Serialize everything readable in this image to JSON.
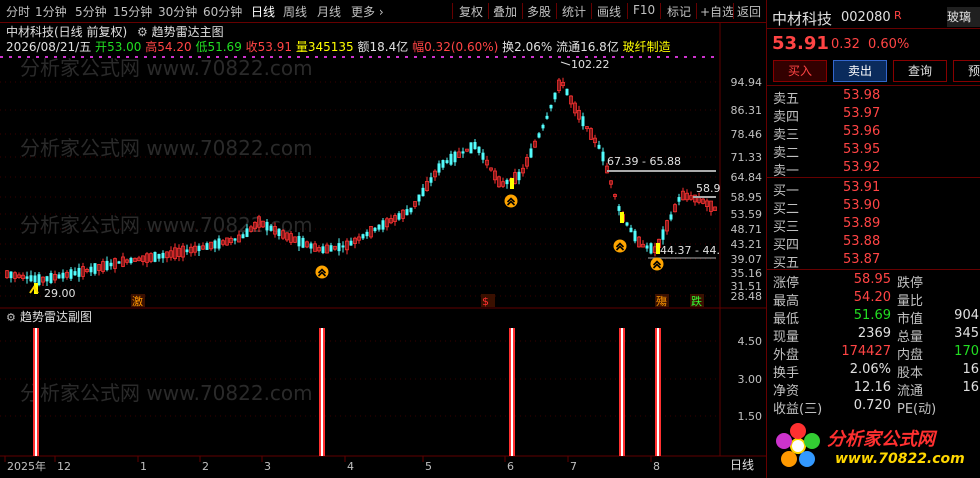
{
  "toolbar": {
    "items": [
      "分时",
      "1分钟",
      "5分钟",
      "15分钟",
      "30分钟",
      "60分钟",
      "日线",
      "周线",
      "月线",
      "更多 ›"
    ],
    "actions": [
      "复权",
      "叠加",
      "多股",
      "统计",
      "画线",
      "F10",
      "标记",
      "+自选",
      "返回"
    ]
  },
  "chart": {
    "title": "中材科技(日线 前复权)",
    "indicator_main": "趋势雷达主图",
    "info_date": "2026/08/21/五",
    "info_open_label": "开",
    "info_open": "53.00",
    "info_high_label": "高",
    "info_high": "54.20",
    "info_low_label": "低",
    "info_low": "51.69",
    "info_close_label": "收",
    "info_close": "53.91",
    "info_vol_label": "量",
    "info_vol": "345135",
    "info_amount_label": "额",
    "info_amount": "18.4亿",
    "info_change_label": "幅",
    "info_change": "0.32(0.60%)",
    "info_turnover": "换2.06%",
    "info_float": "流通16.8亿",
    "info_sector": "玻纤制造",
    "price_axis": [
      "94.94",
      "86.31",
      "78.46",
      "71.33",
      "64.84",
      "58.95",
      "53.59",
      "48.71",
      "43.21",
      "39.07",
      "35.16",
      "31.51",
      "28.48"
    ],
    "annotations": {
      "peak": "102.22",
      "low": "29.00",
      "range1": "67.39 - 65.88",
      "range2": "44.37 - 44.",
      "right_label": "58.9"
    },
    "event_tags": [
      "激",
      "$",
      "殤",
      "跌"
    ],
    "sub_indicator": "趋势雷达副图",
    "sub_axis": [
      "4.50",
      "3.00",
      "1.50"
    ],
    "date_axis": [
      "2025年",
      "12",
      "1",
      "2",
      "3",
      "4",
      "5",
      "6",
      "7",
      "8"
    ],
    "period_label": "日线",
    "watermark": "分析家公式网 www.70822.com"
  },
  "stock": {
    "name": "中材科技",
    "code": "002080",
    "badge": "R",
    "price": "53.91",
    "change": "0.32",
    "change_pct": "0.60%",
    "sector_tab": "玻璃"
  },
  "buttons": {
    "buy": "买入",
    "sell": "卖出",
    "query": "查询",
    "more": "预"
  },
  "order_book": {
    "asks": [
      {
        "label": "卖五",
        "price": "53.98"
      },
      {
        "label": "卖四",
        "price": "53.97"
      },
      {
        "label": "卖三",
        "price": "53.96"
      },
      {
        "label": "卖二",
        "price": "53.95"
      },
      {
        "label": "卖一",
        "price": "53.92"
      }
    ],
    "bids": [
      {
        "label": "买一",
        "price": "53.91"
      },
      {
        "label": "买二",
        "price": "53.90"
      },
      {
        "label": "买三",
        "price": "53.89"
      },
      {
        "label": "买四",
        "price": "53.88"
      },
      {
        "label": "买五",
        "price": "53.87"
      }
    ]
  },
  "stats": [
    {
      "l1": "涨停",
      "v1": "58.95",
      "c1": "red",
      "l2": "跌停",
      "v2": "",
      "c2": "green"
    },
    {
      "l1": "最高",
      "v1": "54.20",
      "c1": "red",
      "l2": "量比",
      "v2": "",
      "c2": "white"
    },
    {
      "l1": "最低",
      "v1": "51.69",
      "c1": "green",
      "l2": "市值",
      "v2": "904",
      "c2": "white"
    },
    {
      "l1": "现量",
      "v1": "2369",
      "c1": "white",
      "l2": "总量",
      "v2": "345",
      "c2": "white"
    },
    {
      "l1": "外盘",
      "v1": "174427",
      "c1": "red",
      "l2": "内盘",
      "v2": "170",
      "c2": "green"
    },
    {
      "l1": "换手",
      "v1": "2.06%",
      "c1": "white",
      "l2": "股本",
      "v2": "16",
      "c2": "white"
    },
    {
      "l1": "净资",
      "v1": "12.16",
      "c1": "white",
      "l2": "流通",
      "v2": "16",
      "c2": "white"
    },
    {
      "l1": "收益(三)",
      "v1": "0.720",
      "c1": "white",
      "l2": "PE(动)",
      "v2": "",
      "c2": "white"
    }
  ],
  "logo": {
    "name": "分析家公式网",
    "url": "www.70822.com"
  },
  "colors": {
    "up": "#ff3232",
    "down": "#54fcfc",
    "bg": "#000000",
    "grid": "#600000",
    "signal": "#ffa500"
  }
}
